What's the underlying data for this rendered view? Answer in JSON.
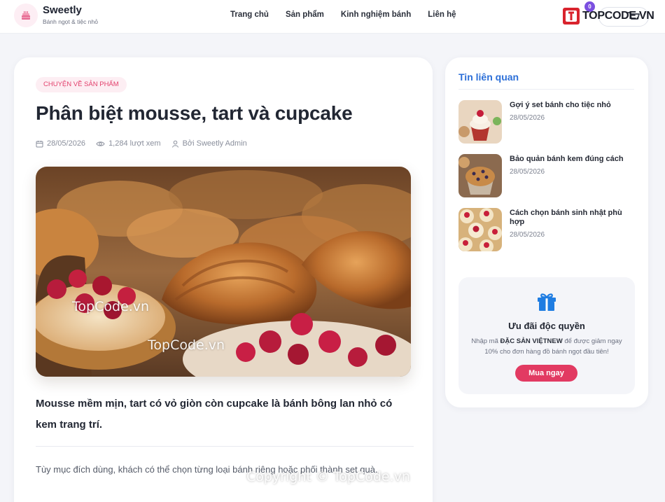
{
  "header": {
    "brand": "Sweetly",
    "tagline": "Bánh ngọt & tiệc nhỏ",
    "nav": [
      "Trang chủ",
      "Sản phẩm",
      "Kinh nghiệm bánh",
      "Liên hệ"
    ],
    "cart_count": "0",
    "watermark_logo": "TOPCODE.VN"
  },
  "article": {
    "category": "CHUYỆN VỀ SẢN PHẨM",
    "title": "Phân biệt mousse, tart và cupcake",
    "date": "28/05/2026",
    "views": "1,284 lượt xem",
    "author": "Bởi Sweetly Admin",
    "lead": "Mousse mềm mịn, tart có vỏ giòn còn cupcake là bánh bông lan nhỏ có kem trang trí.",
    "body": "Tùy mục đích dùng, khách có thể chọn từng loại bánh riêng hoặc phối thành set quà."
  },
  "sidebar": {
    "title": "Tin liên quan",
    "related": [
      {
        "title": "Gợi ý set bánh cho tiệc nhỏ",
        "date": "28/05/2026"
      },
      {
        "title": "Bảo quản bánh kem đúng cách",
        "date": "28/05/2026"
      },
      {
        "title": "Cách chọn bánh sinh nhật phù hợp",
        "date": "28/05/2026"
      }
    ],
    "promo": {
      "title": "Ưu đãi độc quyền",
      "text_prefix": "Nhập mã",
      "code": "ĐẶC SẢN VIỆTNEW",
      "text_suffix": "để được giảm ngay 10% cho đơn hàng đồ bánh ngọt đầu tiên!",
      "button": "Mua ngay"
    }
  },
  "watermarks": {
    "img1": "TopCode.vn",
    "img2": "TopCode.vn",
    "footer": "Copyright © TopCode.vn"
  },
  "colors": {
    "accent_pink": "#e23a62",
    "link_blue": "#2c6fd8",
    "category_bg": "#fdeef3",
    "page_bg": "#f4f5f9"
  }
}
